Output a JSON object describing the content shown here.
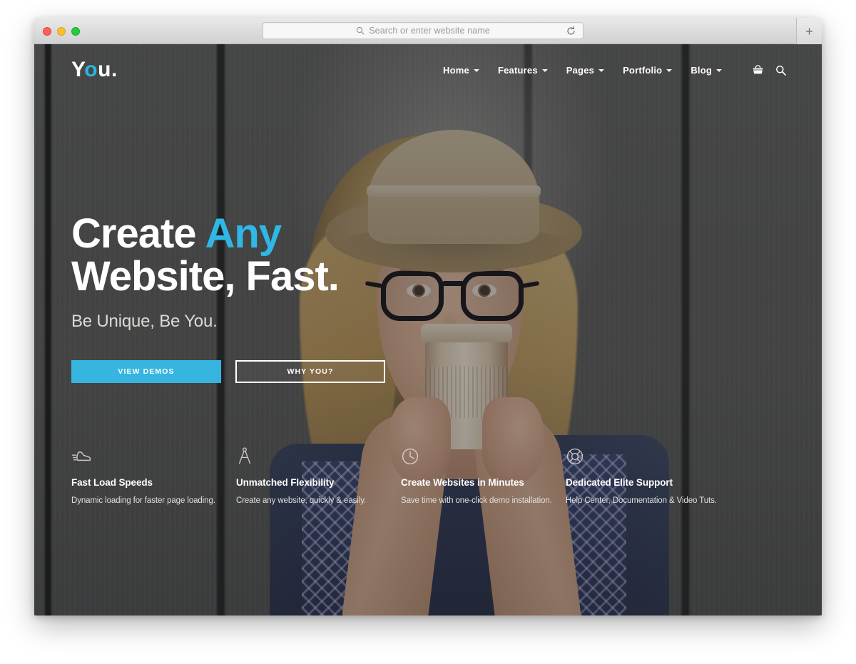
{
  "browser": {
    "traffic_lights": [
      "close",
      "minimize",
      "maximize"
    ],
    "address_placeholder": "Search or enter website name",
    "address_value": "",
    "reload_icon": "reload-icon",
    "search_icon": "search-icon",
    "new_tab_label": "+"
  },
  "site": {
    "logo": {
      "prefix": "Y",
      "accent": "o",
      "suffix": "u."
    },
    "nav": [
      {
        "label": "Home",
        "has_dropdown": true
      },
      {
        "label": "Features",
        "has_dropdown": true
      },
      {
        "label": "Pages",
        "has_dropdown": true
      },
      {
        "label": "Portfolio",
        "has_dropdown": true
      },
      {
        "label": "Blog",
        "has_dropdown": true
      }
    ],
    "nav_icons": [
      {
        "name": "basket-icon"
      },
      {
        "name": "search-icon"
      }
    ],
    "hero": {
      "headline_line1_plain": "Create ",
      "headline_line1_accent": "Any",
      "headline_line2": "Website, Fast.",
      "subheadline": "Be Unique, Be You.",
      "buttons": [
        {
          "label": "VIEW DEMOS",
          "style": "primary"
        },
        {
          "label": "WHY YOU?",
          "style": "ghost"
        }
      ]
    },
    "features": [
      {
        "icon": "sneaker-icon",
        "title": "Fast Load Speeds",
        "desc": "Dynamic loading for faster page loading."
      },
      {
        "icon": "compass-divider-icon",
        "title": "Unmatched Flexibility",
        "desc": "Create any website, quickly & easily."
      },
      {
        "icon": "clock-icon",
        "title": "Create Websites in Minutes",
        "desc": "Save time with one-click demo installation."
      },
      {
        "icon": "lifebuoy-icon",
        "title": "Dedicated Elite Support",
        "desc": "Help Center, Documentation & Video Tuts."
      }
    ]
  },
  "colors": {
    "accent": "#2fb8e6",
    "button_primary": "#35b5e0",
    "text_light": "#ffffff",
    "hero_bg": "#5b5b58"
  }
}
